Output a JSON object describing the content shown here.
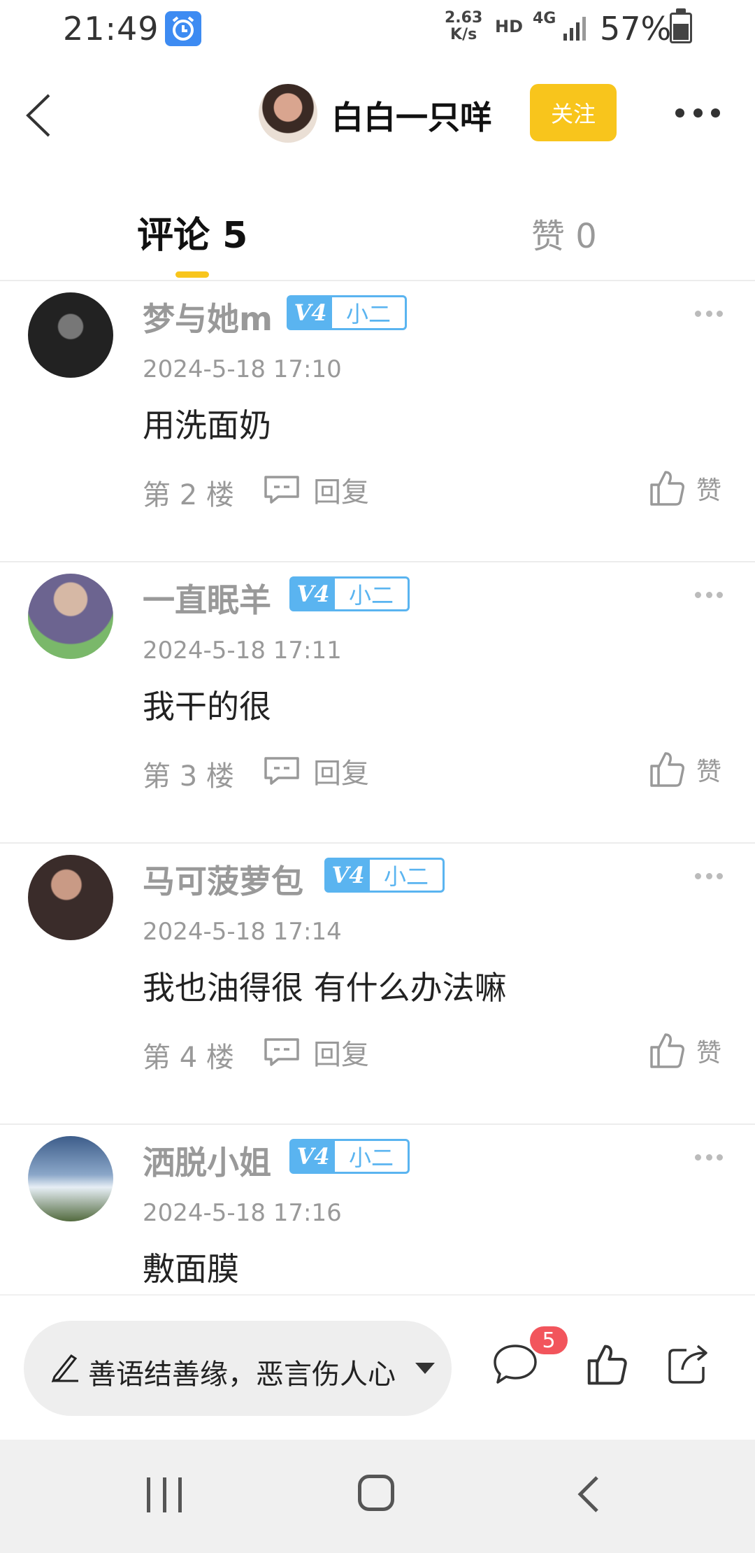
{
  "status_bar": {
    "time": "21:49",
    "net_speed_value": "2.63",
    "net_speed_unit": "K/s",
    "hd": "HD",
    "network": "4G",
    "battery": "57%"
  },
  "header": {
    "username": "白白一只咩",
    "follow_label": "关注"
  },
  "tabs": {
    "comments_label": "评论 5",
    "likes_label": "赞 0"
  },
  "comments": [
    {
      "user": "梦与她m",
      "level": "V4",
      "rank": "小二",
      "time": "2024-5-18 17:10",
      "text": "用洗面奶",
      "floor": "第 2 楼",
      "reply": "回复",
      "like": "赞"
    },
    {
      "user": "一直眠羊",
      "level": "V4",
      "rank": "小二",
      "time": "2024-5-18 17:11",
      "text": "我干的很",
      "floor": "第 3 楼",
      "reply": "回复",
      "like": "赞"
    },
    {
      "user": "马可菠萝包",
      "level": "V4",
      "rank": "小二",
      "time": "2024-5-18 17:14",
      "text": "我也油得很 有什么办法嘛",
      "floor": "第 4 楼",
      "reply": "回复",
      "like": "赞"
    },
    {
      "user": "洒脱小姐",
      "level": "V4",
      "rank": "小二",
      "time": "2024-5-18 17:16",
      "text": "敷面膜",
      "floor": "",
      "reply": "",
      "like": ""
    }
  ],
  "bottom_bar": {
    "input_placeholder": "善语结善缘，恶言伤人心",
    "comment_count": "5"
  },
  "colors": {
    "accent": "#f8c51c",
    "badge_blue": "#5ab4f0",
    "notification": "#f2555c"
  },
  "icons": {
    "back": "back-arrow-icon",
    "more": "more-dots-icon",
    "reply": "reply-bubble-icon",
    "like": "thumbs-up-icon",
    "share": "share-icon",
    "pen": "pen-icon"
  }
}
